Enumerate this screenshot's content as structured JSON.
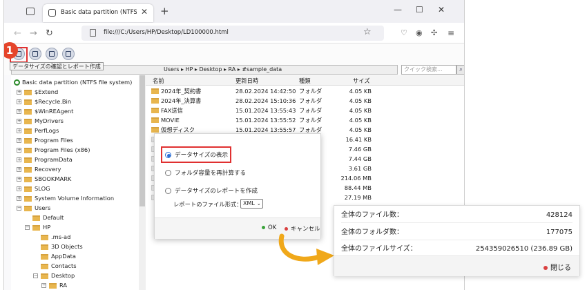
{
  "colors": {
    "accent_red": "#e03030",
    "folder": "#e8b64f",
    "arrow": "#f0a81a",
    "ok_green": "#3aa33a",
    "cancel_red": "#d94040",
    "radio_blue": "#2b6fd6"
  },
  "browser": {
    "tab_title": "Basic data partition (NTFS file s",
    "url": "file:///C:/Users/HP/Desktop/LD100000.html",
    "icons": [
      "tab-list-icon",
      "close-icon",
      "plus-icon",
      "minimize-icon",
      "maximize-icon",
      "window-close-icon",
      "back-icon",
      "forward-icon",
      "reload-icon",
      "page-icon",
      "star-icon",
      "pocket-icon",
      "account-icon",
      "extensions-icon",
      "menu-icon"
    ]
  },
  "app": {
    "step_badge": "1",
    "tooltip": "データサイズの確認とレポート作成",
    "breadcrumb": "Users ▸ HP ▸ Desktop ▸ RA ▸ #sample_data",
    "search_placeholder": "クイック検索..."
  },
  "tree": {
    "root": "Basic data partition (NTFS file system)",
    "items": [
      {
        "label": "$Extend"
      },
      {
        "label": "$Recycle.Bin"
      },
      {
        "label": "$WinREAgent"
      },
      {
        "label": "MyDrivers"
      },
      {
        "label": "PerfLogs"
      },
      {
        "label": "Program Files"
      },
      {
        "label": "Program Files (x86)"
      },
      {
        "label": "ProgramData"
      },
      {
        "label": "Recovery"
      },
      {
        "label": "SBOOKMARK"
      },
      {
        "label": "SLOG"
      },
      {
        "label": "System Volume Information"
      },
      {
        "label": "Users"
      },
      {
        "label": "Default"
      },
      {
        "label": "HP"
      },
      {
        "label": ".ms-ad"
      },
      {
        "label": "3D Objects"
      },
      {
        "label": "AppData"
      },
      {
        "label": "Contacts"
      },
      {
        "label": "Desktop"
      },
      {
        "label": "RA"
      }
    ]
  },
  "list": {
    "headers": {
      "name": "名前",
      "date": "更新日時",
      "type": "種類",
      "size": "サイズ"
    },
    "rows": [
      {
        "name": "2024年_契約書",
        "date": "28.02.2024 14:42:50",
        "type": "フォルダ",
        "size": "4.05 KB"
      },
      {
        "name": "2024年_決算書",
        "date": "28.02.2024 15:10:36",
        "type": "フォルダ",
        "size": "4.05 KB"
      },
      {
        "name": "FAX送信",
        "date": "15.01.2024 13:55:43",
        "type": "フォルダ",
        "size": "4.05 KB"
      },
      {
        "name": "MOVIE",
        "date": "15.01.2024 13:55:52",
        "type": "フォルダ",
        "size": "4.05 KB"
      },
      {
        "name": "仮想ディスク",
        "date": "15.01.2024 13:55:57",
        "type": "フォルダ",
        "size": "4.05 KB"
      },
      {
        "name": "",
        "date": "",
        "type": "",
        "size": "16.41 KB"
      },
      {
        "name": "",
        "date": "",
        "type": "",
        "size": "7.46 GB"
      },
      {
        "name": "",
        "date": "",
        "type": "",
        "size": "7.44 GB"
      },
      {
        "name": "",
        "date": "",
        "type": "",
        "size": "3.61 GB"
      },
      {
        "name": "",
        "date": "",
        "type": "",
        "size": "214.06 MB"
      },
      {
        "name": "",
        "date": "",
        "type": "",
        "size": "88.44 MB"
      },
      {
        "name": "",
        "date": "",
        "type": "",
        "size": "27.19 MB"
      }
    ]
  },
  "dialog": {
    "option_show": "データサイズの表示",
    "option_recalc": "フォルダ容量を再計算する",
    "option_report": "データサイズのレポートを作成",
    "format_label": "レポートのファイル形式：",
    "format_value": "XML",
    "ok": "OK",
    "cancel": "キャンセル"
  },
  "stats": {
    "files_label": "全体のファイル数：",
    "files_value": "428124",
    "folders_label": "全体のフォルダ数：",
    "folders_value": "177075",
    "size_label": "全体のファイルサイズ：",
    "size_value": "254359026510 (236.89 GB)",
    "close": "閉じる"
  }
}
